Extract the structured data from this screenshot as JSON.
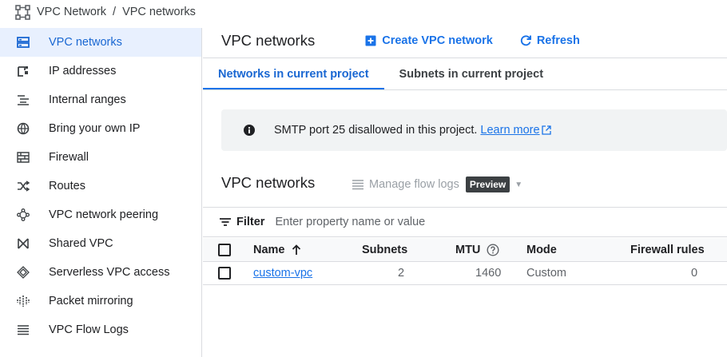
{
  "breadcrumb": {
    "root": "VPC Network",
    "separator": "/",
    "current": "VPC networks"
  },
  "sidebar": {
    "items": [
      {
        "label": "VPC networks",
        "icon": "vpc-networks-icon",
        "active": true
      },
      {
        "label": "IP addresses",
        "icon": "ip-addresses-icon"
      },
      {
        "label": "Internal ranges",
        "icon": "internal-ranges-icon"
      },
      {
        "label": "Bring your own IP",
        "icon": "globe-icon"
      },
      {
        "label": "Firewall",
        "icon": "firewall-icon"
      },
      {
        "label": "Routes",
        "icon": "routes-icon"
      },
      {
        "label": "VPC network peering",
        "icon": "peering-icon"
      },
      {
        "label": "Shared VPC",
        "icon": "shared-vpc-icon"
      },
      {
        "label": "Serverless VPC access",
        "icon": "serverless-icon"
      },
      {
        "label": "Packet mirroring",
        "icon": "packet-mirroring-icon"
      },
      {
        "label": "VPC Flow Logs",
        "icon": "flow-logs-icon"
      }
    ]
  },
  "header": {
    "title": "VPC networks",
    "create_label": "Create VPC network",
    "refresh_label": "Refresh"
  },
  "tabs": [
    {
      "label": "Networks in current project",
      "active": true
    },
    {
      "label": "Subnets in current project",
      "active": false
    }
  ],
  "banner": {
    "text": "SMTP port 25 disallowed in this project.",
    "link": "Learn more"
  },
  "section": {
    "title": "VPC networks",
    "flow_logs_label": "Manage flow logs",
    "badge": "Preview"
  },
  "filter": {
    "label": "Filter",
    "placeholder": "Enter property name or value"
  },
  "table": {
    "columns": [
      "Name",
      "Subnets",
      "MTU",
      "Mode",
      "Firewall rules"
    ],
    "rows": [
      {
        "name": "custom-vpc",
        "subnets": "2",
        "mtu": "1460",
        "mode": "Custom",
        "firewall_rules": "0"
      }
    ]
  },
  "colors": {
    "accent": "#1a73e8",
    "active_bg": "#e8f0fe",
    "banner_bg": "#f1f3f4",
    "badge_bg": "#3c4043"
  }
}
